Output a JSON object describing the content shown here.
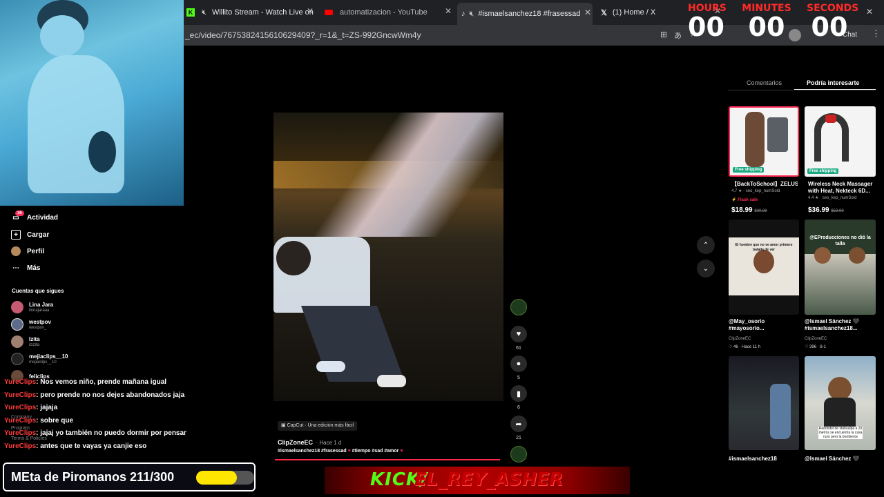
{
  "browser": {
    "tabs": [
      {
        "label": "Willito Stream - Watch Live on",
        "icon": "kick-icon"
      },
      {
        "label": "automatizacion - YouTube",
        "icon": "youtube-icon"
      },
      {
        "label": "#ismaelsanchez18 #frasessad",
        "icon": "tiktok-icon"
      },
      {
        "label": "(1) Home / X",
        "icon": "x-icon"
      }
    ],
    "url": "_ec/video/7675382415610629409?_r=1&_t=ZS-992GncwWm4y",
    "chat_label": "Chat"
  },
  "timer": {
    "hours_label": "HOURS",
    "hours_value": "00",
    "minutes_label": "MINUTES",
    "minutes_value": "00",
    "seconds_label": "SECONDS",
    "seconds_value": "00"
  },
  "tiktok_nav": {
    "items": [
      {
        "label": "Actividad",
        "icon": "inbox-icon"
      },
      {
        "label": "Cargar",
        "icon": "upload-icon"
      },
      {
        "label": "Perfil",
        "icon": "avatar"
      },
      {
        "label": "Más",
        "icon": "more-icon"
      }
    ],
    "activity_badge": "36",
    "following_header": "Cuentas que sigues",
    "following": [
      {
        "name": "Lina Jara",
        "handle": "linnajaraaa"
      },
      {
        "name": "westpov",
        "handle": "westpov_"
      },
      {
        "name": "Izita",
        "handle": "izizita"
      },
      {
        "name": "mejiaclips__10",
        "handle": "mejiaclips__10"
      },
      {
        "name": "feliclips",
        "handle": ""
      }
    ],
    "footer": [
      "Company",
      "Program",
      "Terms & Policies"
    ]
  },
  "chat": [
    {
      "user": "YureClips",
      "message": ": Nos vemos niño, prende mañana igual"
    },
    {
      "user": "YureClips",
      "message": ": pero prende no nos dejes abandonados jaja"
    },
    {
      "user": "YureClips",
      "message": ": jajaja"
    },
    {
      "user": "YureClips",
      "message": ": sobre que"
    },
    {
      "user": "YureClips",
      "message": ": jajaj yo también no puedo dormir por pensar"
    },
    {
      "user": "YureClips",
      "message": ": antes que te vayas ya canjie eso"
    }
  ],
  "goal": {
    "text": "MEta de Piromanos 211/300",
    "current": 211,
    "target": 300,
    "color": "#ffe600"
  },
  "kick_banner": {
    "kick": "KICK/",
    "name": "EL_REY_ASHER"
  },
  "video": {
    "capcut_label": "CapCut · Una edición más fácil",
    "author": "ClipZoneEC",
    "time_ago": "· Hace 1 d",
    "caption": "#ismaelsanchez18 #frasessad",
    "caption_tags": "#tiempo #sad #amor",
    "likes": "61",
    "comments": "5",
    "saves": "6",
    "shares": "21"
  },
  "right_panel": {
    "tabs": [
      "Comentarios",
      "Podría interesarte"
    ],
    "products": [
      {
        "title": "【BackToSchool】ZELUS...",
        "rating": "4.7 ★ · seo_kep_numSold",
        "tag": "Flash sale",
        "price": "$18.99",
        "old_price": "$30.99",
        "badge": "Free shipping"
      },
      {
        "title": "Wireless Neck Massager with Heat, Nekteck 6D...",
        "rating": "4.4 ★ · seo_kep_numSold",
        "price": "$36.99",
        "old_price": "$59.99",
        "badge": "Free shipping"
      }
    ],
    "videos": [
      {
        "overlay": "El hombre que no ve amor primero batalla de ver",
        "title": "@May_osorio #mayosorio...",
        "author": "ClipZoneEC",
        "stats": "♡ 46 · Hace 11 h"
      },
      {
        "overlay": "@EProducciones no dió la talla",
        "title": "@Ismael Sánchez 🖤 #ismaelsanchez18...",
        "author": "ClipZoneEC",
        "stats": "♡ 396 · 8-1"
      },
      {
        "overlay": "",
        "title": "#ismaelsanchez18",
        "author": "",
        "stats": ""
      },
      {
        "overlay": "Redondel de stahualpa a 20 metros se encuentra la casa ruyo pero la bomberos",
        "title": "@Ismael Sánchez 🖤",
        "author": "",
        "stats": ""
      }
    ]
  }
}
